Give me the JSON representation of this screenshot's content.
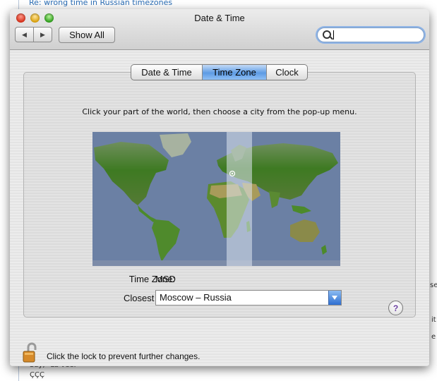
{
  "background": {
    "link": "Re: wrong time in Russian timezones",
    "fragments": [
      "se",
      "it",
      "e",
      "Say, \"La vee.\"",
      "ÇÇÇ"
    ]
  },
  "window": {
    "title": "Date & Time",
    "toolbar": {
      "back": "◀",
      "forward": "▶",
      "show_all": "Show All",
      "search_value": ""
    },
    "tabs": [
      {
        "label": "Date & Time",
        "active": false
      },
      {
        "label": "Time Zone",
        "active": true
      },
      {
        "label": "Clock",
        "active": false
      }
    ],
    "instruction": "Click your part of the world, then choose a city from the pop-up menu.",
    "time_zone_label": "Time Zone:",
    "time_zone_value": "MSD",
    "closest_city_label": "Closest City:",
    "closest_city_value": "Moscow – Russia",
    "help": "?",
    "lock_text": "Click the lock to prevent further changes."
  },
  "colors": {
    "accent": "#5d9be4",
    "ocean": "#6b80a4",
    "land": "#3f7a26",
    "highlight_band": "#c9d3e2"
  }
}
